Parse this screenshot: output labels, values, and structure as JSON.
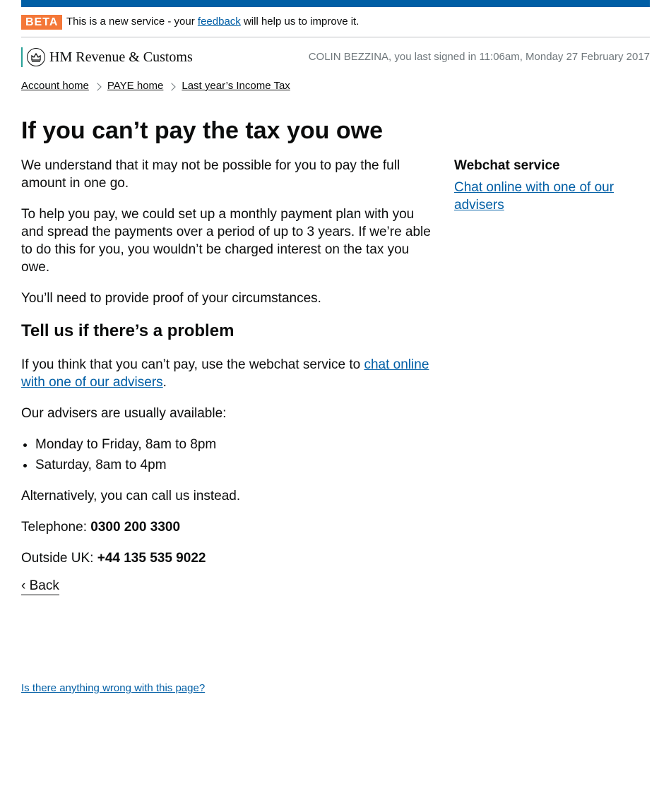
{
  "banner": {
    "tag": "BETA",
    "text_before": "This is a new service - your",
    "link": "feedback",
    "text_after": "will help us to improve it."
  },
  "header": {
    "logo_text": "HM Revenue & Customs",
    "signed_in": "COLIN BEZZINA, you last signed in 11:06am, Monday 27 February 2017"
  },
  "breadcrumb": [
    "Account home",
    "PAYE home",
    "Last year’s Income Tax"
  ],
  "page": {
    "title": "If you can’t pay the tax you owe",
    "p1": "We understand that it may not be possible for you to pay the full amount in one go.",
    "p2": "To help you pay, we could set up a monthly payment plan with you and spread the payments over a period of up to 3 years. If we’re able to do this for you, you wouldn’t be charged interest on the tax you owe.",
    "p3": "You’ll need to provide proof of your circumstances.",
    "heading2": "Tell us if there’s a problem",
    "p4_before": "If you think that you can’t pay, use the webchat service to",
    "p4_link": "chat online with one of our advisers",
    "p4_after": ".",
    "p5": "Our advisers are usually available:",
    "hours": [
      "Monday to Friday, 8am to 8pm",
      "Saturday, 8am to 4pm"
    ],
    "p6": "Alternatively, you can call us instead.",
    "telephone_label": "Telephone:",
    "telephone": "0300 200 3300",
    "outside_label": "Outside UK:",
    "outside": "+44 135 535 9022",
    "back": "‹ Back"
  },
  "aside": {
    "heading": "Webchat service",
    "link": "Chat online with one of our advisers"
  },
  "footer": {
    "report": "Is there anything wrong with this page?"
  }
}
